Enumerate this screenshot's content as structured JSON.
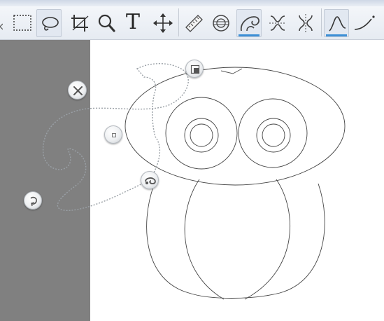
{
  "toolbar": {
    "tools": [
      {
        "name": "rectangle-select-tool",
        "icon": "dashed-rectangle-icon"
      },
      {
        "name": "lasso-select-tool",
        "icon": "lasso-icon",
        "selected": true
      },
      {
        "name": "crop-tool",
        "icon": "crop-icon"
      },
      {
        "name": "zoom-tool",
        "icon": "magnifier-icon"
      },
      {
        "name": "text-tool",
        "icon": "text-icon",
        "glyph": "T"
      },
      {
        "name": "move-tool",
        "icon": "move-arrows-icon"
      },
      {
        "name": "ruler-tool",
        "icon": "ruler-icon"
      },
      {
        "name": "circle-target-tool",
        "icon": "target-circle-icon"
      },
      {
        "name": "curve-warp-tool",
        "icon": "hand-curve-icon",
        "active": true
      },
      {
        "name": "flip-horizontal-tool",
        "icon": "horizontal-flip-icon"
      },
      {
        "name": "flip-vertical-tool",
        "icon": "vertical-flip-icon"
      },
      {
        "name": "freeform-line-tool",
        "icon": "freeform-line-icon",
        "active": true
      },
      {
        "name": "smooth-curve-tool",
        "icon": "smooth-curve-icon"
      }
    ],
    "accent_color": "#3c8fd6"
  },
  "workspace": {
    "side_panel_color": "#808080",
    "canvas_color": "#ffffff"
  },
  "selection_handles": [
    {
      "name": "close-handle",
      "icon": "close-icon"
    },
    {
      "name": "anchor-handle",
      "icon": "square-dot-icon"
    },
    {
      "name": "rotate-handle",
      "icon": "rotate-icon"
    },
    {
      "name": "resize-handle",
      "icon": "resize-corner-icon"
    },
    {
      "name": "transform-handle",
      "icon": "warp-icon"
    }
  ]
}
